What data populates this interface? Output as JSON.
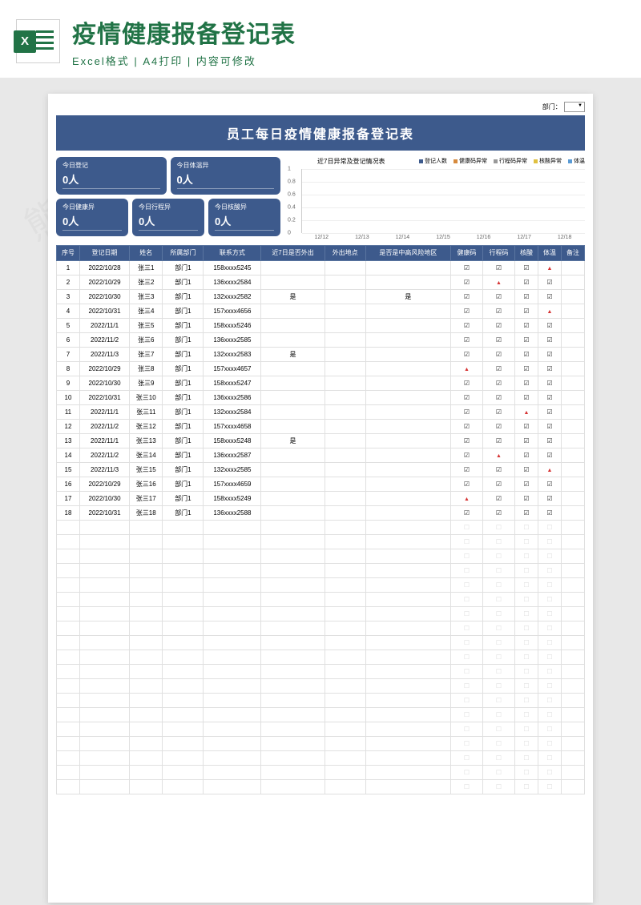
{
  "banner": {
    "icon_letter": "X",
    "title": "疫情健康报备登记表",
    "subtitle": "Excel格式 | A4打印 | 内容可修改"
  },
  "doc": {
    "dept_label": "部门：",
    "title": "员工每日疫情健康报备登记表",
    "cards": {
      "today_register": {
        "label": "今日登记",
        "value": "0人"
      },
      "today_temp": {
        "label": "今日体温异",
        "value": "0人"
      },
      "today_health": {
        "label": "今日健康异",
        "value": "0人"
      },
      "today_travel": {
        "label": "今日行程异",
        "value": "0人"
      },
      "today_nucleic": {
        "label": "今日核酸异",
        "value": "0人"
      }
    },
    "chart": {
      "title": "近7日异常及登记情况表",
      "legend": [
        {
          "name": "登记人数",
          "color": "#3d5a8c"
        },
        {
          "name": "健康码异常",
          "color": "#d68a3d"
        },
        {
          "name": "行程码异常",
          "color": "#999"
        },
        {
          "name": "核酸异常",
          "color": "#e0c040"
        },
        {
          "name": "体温",
          "color": "#5a9bd5"
        }
      ],
      "y_ticks": [
        "1",
        "0.8",
        "0.6",
        "0.4",
        "0.2",
        "0"
      ],
      "x_labels": [
        "12/12",
        "12/13",
        "12/14",
        "12/15",
        "12/16",
        "12/17",
        "12/18"
      ]
    },
    "columns": [
      "序号",
      "登记日期",
      "姓名",
      "所属部门",
      "联系方式",
      "近7日是否外出",
      "外出地点",
      "是否是中高风险地区",
      "健康码",
      "行程码",
      "核酸",
      "体温",
      "备注"
    ],
    "rows": [
      {
        "n": "1",
        "date": "2022/10/28",
        "name": "张三1",
        "dept": "部门1",
        "phone": "158xxxx5245",
        "out": "",
        "loc": "",
        "risk": "",
        "h": "☑",
        "t": "☑",
        "k": "☑",
        "temp": "▲",
        "note": ""
      },
      {
        "n": "2",
        "date": "2022/10/29",
        "name": "张三2",
        "dept": "部门1",
        "phone": "136xxxx2584",
        "out": "",
        "loc": "",
        "risk": "",
        "h": "☑",
        "t": "▲",
        "k": "☑",
        "temp": "☑",
        "note": ""
      },
      {
        "n": "3",
        "date": "2022/10/30",
        "name": "张三3",
        "dept": "部门1",
        "phone": "132xxxx2582",
        "out": "是",
        "loc": "",
        "risk": "是",
        "h": "☑",
        "t": "☑",
        "k": "☑",
        "temp": "☑",
        "note": ""
      },
      {
        "n": "4",
        "date": "2022/10/31",
        "name": "张三4",
        "dept": "部门1",
        "phone": "157xxxx4656",
        "out": "",
        "loc": "",
        "risk": "",
        "h": "☑",
        "t": "☑",
        "k": "☑",
        "temp": "▲",
        "note": ""
      },
      {
        "n": "5",
        "date": "2022/11/1",
        "name": "张三5",
        "dept": "部门1",
        "phone": "158xxxx5246",
        "out": "",
        "loc": "",
        "risk": "",
        "h": "☑",
        "t": "☑",
        "k": "☑",
        "temp": "☑",
        "note": ""
      },
      {
        "n": "6",
        "date": "2022/11/2",
        "name": "张三6",
        "dept": "部门1",
        "phone": "136xxxx2585",
        "out": "",
        "loc": "",
        "risk": "",
        "h": "☑",
        "t": "☑",
        "k": "☑",
        "temp": "☑",
        "note": ""
      },
      {
        "n": "7",
        "date": "2022/11/3",
        "name": "张三7",
        "dept": "部门1",
        "phone": "132xxxx2583",
        "out": "是",
        "loc": "",
        "risk": "",
        "h": "☑",
        "t": "☑",
        "k": "☑",
        "temp": "☑",
        "note": ""
      },
      {
        "n": "8",
        "date": "2022/10/29",
        "name": "张三8",
        "dept": "部门1",
        "phone": "157xxxx4657",
        "out": "",
        "loc": "",
        "risk": "",
        "h": "▲",
        "t": "☑",
        "k": "☑",
        "temp": "☑",
        "note": ""
      },
      {
        "n": "9",
        "date": "2022/10/30",
        "name": "张三9",
        "dept": "部门1",
        "phone": "158xxxx5247",
        "out": "",
        "loc": "",
        "risk": "",
        "h": "☑",
        "t": "☑",
        "k": "☑",
        "temp": "☑",
        "note": ""
      },
      {
        "n": "10",
        "date": "2022/10/31",
        "name": "张三10",
        "dept": "部门1",
        "phone": "136xxxx2586",
        "out": "",
        "loc": "",
        "risk": "",
        "h": "☑",
        "t": "☑",
        "k": "☑",
        "temp": "☑",
        "note": ""
      },
      {
        "n": "11",
        "date": "2022/11/1",
        "name": "张三11",
        "dept": "部门1",
        "phone": "132xxxx2584",
        "out": "",
        "loc": "",
        "risk": "",
        "h": "☑",
        "t": "☑",
        "k": "▲",
        "temp": "☑",
        "note": ""
      },
      {
        "n": "12",
        "date": "2022/11/2",
        "name": "张三12",
        "dept": "部门1",
        "phone": "157xxxx4658",
        "out": "",
        "loc": "",
        "risk": "",
        "h": "☑",
        "t": "☑",
        "k": "☑",
        "temp": "☑",
        "note": ""
      },
      {
        "n": "13",
        "date": "2022/11/1",
        "name": "张三13",
        "dept": "部门1",
        "phone": "158xxxx5248",
        "out": "是",
        "loc": "",
        "risk": "",
        "h": "☑",
        "t": "☑",
        "k": "☑",
        "temp": "☑",
        "note": ""
      },
      {
        "n": "14",
        "date": "2022/11/2",
        "name": "张三14",
        "dept": "部门1",
        "phone": "136xxxx2587",
        "out": "",
        "loc": "",
        "risk": "",
        "h": "☑",
        "t": "▲",
        "k": "☑",
        "temp": "☑",
        "note": ""
      },
      {
        "n": "15",
        "date": "2022/11/3",
        "name": "张三15",
        "dept": "部门1",
        "phone": "132xxxx2585",
        "out": "",
        "loc": "",
        "risk": "",
        "h": "☑",
        "t": "☑",
        "k": "☑",
        "temp": "▲",
        "note": ""
      },
      {
        "n": "16",
        "date": "2022/10/29",
        "name": "张三16",
        "dept": "部门1",
        "phone": "157xxxx4659",
        "out": "",
        "loc": "",
        "risk": "",
        "h": "☑",
        "t": "☑",
        "k": "☑",
        "temp": "☑",
        "note": ""
      },
      {
        "n": "17",
        "date": "2022/10/30",
        "name": "张三17",
        "dept": "部门1",
        "phone": "158xxxx5249",
        "out": "",
        "loc": "",
        "risk": "",
        "h": "▲",
        "t": "☑",
        "k": "☑",
        "temp": "☑",
        "note": ""
      },
      {
        "n": "18",
        "date": "2022/10/31",
        "name": "张三18",
        "dept": "部门1",
        "phone": "136xxxx2588",
        "out": "",
        "loc": "",
        "risk": "",
        "h": "☑",
        "t": "☑",
        "k": "☑",
        "temp": "☑",
        "note": ""
      }
    ],
    "empty_rows": 19
  },
  "chart_data": {
    "type": "line",
    "title": "近7日异常及登记情况表",
    "categories": [
      "12/12",
      "12/13",
      "12/14",
      "12/15",
      "12/16",
      "12/17",
      "12/18"
    ],
    "series": [
      {
        "name": "登记人数",
        "values": [
          0,
          0,
          0,
          0,
          0,
          0,
          0
        ]
      },
      {
        "name": "健康码异常",
        "values": [
          0,
          0,
          0,
          0,
          0,
          0,
          0
        ]
      },
      {
        "name": "行程码异常",
        "values": [
          0,
          0,
          0,
          0,
          0,
          0,
          0
        ]
      },
      {
        "name": "核酸异常",
        "values": [
          0,
          0,
          0,
          0,
          0,
          0,
          0
        ]
      },
      {
        "name": "体温",
        "values": [
          0,
          0,
          0,
          0,
          0,
          0,
          0
        ]
      }
    ],
    "ylim": [
      0,
      1
    ],
    "xlabel": "",
    "ylabel": ""
  }
}
